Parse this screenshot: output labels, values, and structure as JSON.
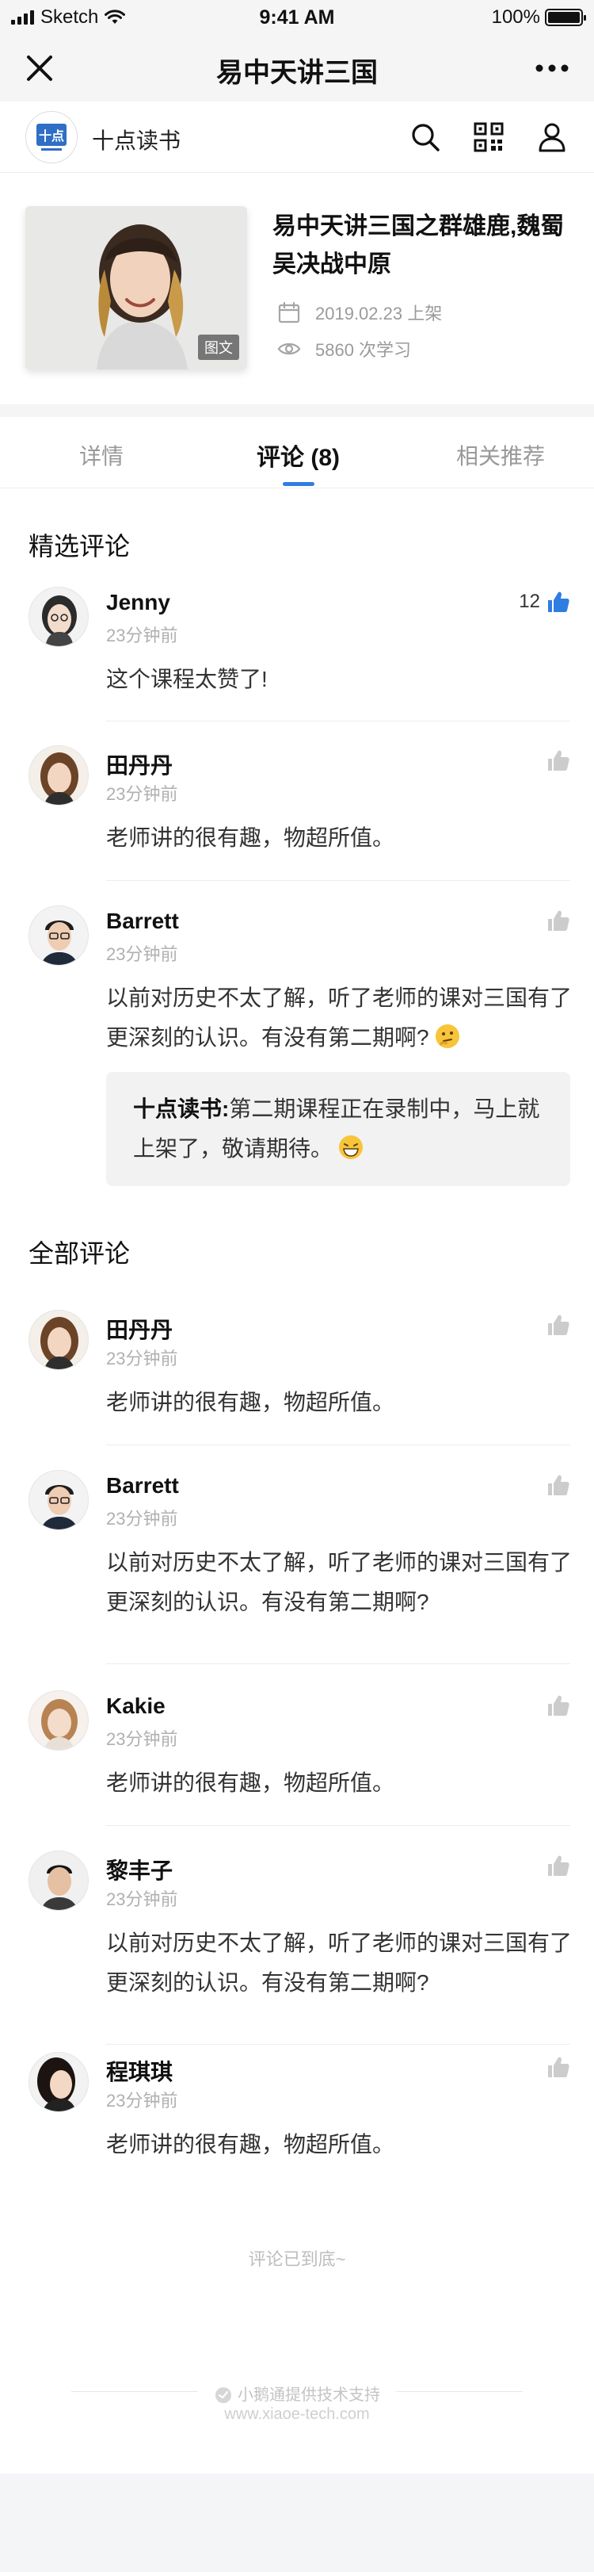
{
  "status_bar": {
    "carrier": "Sketch",
    "time": "9:41 AM",
    "battery": "100%"
  },
  "navbar": {
    "title": "易中天讲三国",
    "close_icon": "close-icon",
    "more_icon": "more-icon"
  },
  "shop": {
    "name": "十点读书",
    "logo_text": "十点"
  },
  "course": {
    "title": "易中天讲三国之群雄鹿,魏蜀吴决战中原",
    "cover_tag": "图文",
    "date": "2019.02.23 上架",
    "views": "5860 次学习"
  },
  "tabs": [
    {
      "label": "详情"
    },
    {
      "label": "评论 (8)",
      "active": true
    },
    {
      "label": "相关推荐"
    }
  ],
  "featured": {
    "title": "精选评论",
    "comments": [
      {
        "name": "Jenny",
        "time": "23分钟前",
        "text": "这个课程太赞了!",
        "likes": "12",
        "liked": true
      },
      {
        "name": "田丹丹",
        "time": "23分钟前",
        "text": "老师讲的很有趣，物超所值。"
      },
      {
        "name": "Barrett",
        "time": "23分钟前",
        "text": "以前对历史不太了解，听了老师的课对三国有了更深刻的认识。有没有第二期啊?",
        "reply": {
          "author": "十点读书:",
          "text": "第二期课程正在录制中，马上就上架了，敬请期待。"
        }
      }
    ]
  },
  "all": {
    "title": "全部评论",
    "comments": [
      {
        "name": "田丹丹",
        "time": "23分钟前",
        "text": "老师讲的很有趣，物超所值。"
      },
      {
        "name": "Barrett",
        "time": "23分钟前",
        "text": "以前对历史不太了解，听了老师的课对三国有了更深刻的认识。有没有第二期啊?"
      },
      {
        "name": "Kakie",
        "time": "23分钟前",
        "text": "老师讲的很有趣，物超所值。"
      },
      {
        "name": "黎丰子",
        "time": "23分钟前",
        "text": "以前对历史不太了解，听了老师的课对三国有了更深刻的认识。有没有第二期啊?"
      },
      {
        "name": "程琪琪",
        "time": "23分钟前",
        "text": "老师讲的很有趣，物超所值。"
      }
    ]
  },
  "end_text": "评论已到底~",
  "footer": {
    "provider": "小鹅通提供技术支持",
    "url": "www.xiaoe-tech.com"
  },
  "colors": {
    "accent": "#2f7de1",
    "like_inactive": "#cccccc"
  }
}
